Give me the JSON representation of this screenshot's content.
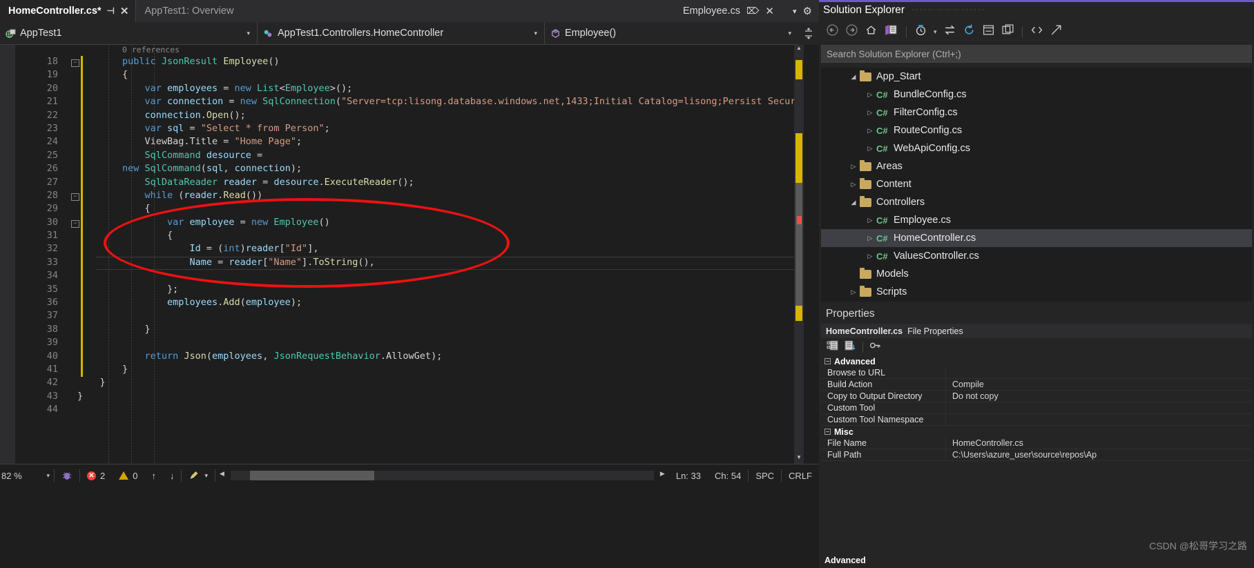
{
  "tabs": [
    {
      "label": "HomeController.cs*",
      "active": true,
      "pin": "⊣",
      "close": "✕"
    },
    {
      "label": "AppTest1: Overview",
      "active": false
    }
  ],
  "right_tab": {
    "label": "Employee.cs",
    "pin_icon": "pin-icon",
    "close": "✕",
    "dropdown": "▾",
    "gear": "⚙"
  },
  "navbar": {
    "project": "AppTest1",
    "class": "AppTest1.Controllers.HomeController",
    "member": "Employee()",
    "caret": "▾",
    "splitter_icon": "split-window-icon"
  },
  "editor": {
    "codelens": "0 references",
    "first_line": 18,
    "current_line": 33,
    "lines": [
      {
        "n": 18,
        "fold": "−",
        "change": true,
        "indent": 0,
        "tokens": [
          {
            "t": "public ",
            "c": "kw"
          },
          {
            "t": "JsonResult ",
            "c": "ty"
          },
          {
            "t": "Employee",
            "c": "me"
          },
          {
            "t": "()",
            "c": "pl"
          }
        ]
      },
      {
        "n": 19,
        "fold": "",
        "change": true,
        "indent": 0,
        "tokens": [
          {
            "t": "{",
            "c": "pl"
          }
        ]
      },
      {
        "n": 20,
        "fold": "",
        "change": true,
        "indent": 1,
        "tokens": [
          {
            "t": "var ",
            "c": "kw"
          },
          {
            "t": "employees",
            "c": "va"
          },
          {
            "t": " = ",
            "c": "pl"
          },
          {
            "t": "new ",
            "c": "kw"
          },
          {
            "t": "List",
            "c": "ty"
          },
          {
            "t": "<",
            "c": "pl"
          },
          {
            "t": "Employee",
            "c": "ty"
          },
          {
            "t": ">();",
            "c": "pl"
          }
        ]
      },
      {
        "n": 21,
        "fold": "",
        "change": true,
        "indent": 1,
        "tokens": [
          {
            "t": "var ",
            "c": "kw"
          },
          {
            "t": "connection",
            "c": "va"
          },
          {
            "t": " = ",
            "c": "pl"
          },
          {
            "t": "new ",
            "c": "kw"
          },
          {
            "t": "SqlConnection",
            "c": "ty"
          },
          {
            "t": "(",
            "c": "pl"
          },
          {
            "t": "\"Server=tcp:lisong.database.windows.net,1433;Initial Catalog=lisong;Persist Secur",
            "c": "st"
          }
        ]
      },
      {
        "n": 22,
        "fold": "",
        "change": true,
        "indent": 1,
        "tokens": [
          {
            "t": "connection",
            "c": "va"
          },
          {
            "t": ".",
            "c": "pl"
          },
          {
            "t": "Open",
            "c": "me"
          },
          {
            "t": "();",
            "c": "pl"
          }
        ]
      },
      {
        "n": 23,
        "fold": "",
        "change": true,
        "indent": 1,
        "tokens": [
          {
            "t": "var ",
            "c": "kw"
          },
          {
            "t": "sql",
            "c": "va"
          },
          {
            "t": " = ",
            "c": "pl"
          },
          {
            "t": "\"Select * from Person\"",
            "c": "st"
          },
          {
            "t": ";",
            "c": "pl"
          }
        ]
      },
      {
        "n": 24,
        "fold": "",
        "change": true,
        "indent": 1,
        "tokens": [
          {
            "t": "ViewBag",
            "c": "pl"
          },
          {
            "t": ".",
            "c": "pl"
          },
          {
            "t": "Title",
            "c": "pl"
          },
          {
            "t": " = ",
            "c": "pl"
          },
          {
            "t": "\"Home Page\"",
            "c": "st"
          },
          {
            "t": ";",
            "c": "pl"
          }
        ]
      },
      {
        "n": 25,
        "fold": "",
        "change": true,
        "indent": 1,
        "tokens": [
          {
            "t": "SqlCommand ",
            "c": "ty"
          },
          {
            "t": "desource",
            "c": "va"
          },
          {
            "t": " =",
            "c": "pl"
          }
        ]
      },
      {
        "n": 26,
        "fold": "",
        "change": true,
        "indent": -1,
        "tokens": [
          {
            "t": "new ",
            "c": "kw"
          },
          {
            "t": "SqlCommand",
            "c": "ty"
          },
          {
            "t": "(",
            "c": "pl"
          },
          {
            "t": "sql",
            "c": "va"
          },
          {
            "t": ", ",
            "c": "pl"
          },
          {
            "t": "connection",
            "c": "va"
          },
          {
            "t": ");",
            "c": "pl"
          }
        ]
      },
      {
        "n": 27,
        "fold": "",
        "change": true,
        "indent": 1,
        "tokens": [
          {
            "t": "SqlDataReader ",
            "c": "ty"
          },
          {
            "t": "reader",
            "c": "va"
          },
          {
            "t": " = ",
            "c": "pl"
          },
          {
            "t": "desource",
            "c": "va"
          },
          {
            "t": ".",
            "c": "pl"
          },
          {
            "t": "ExecuteReader",
            "c": "me"
          },
          {
            "t": "();",
            "c": "pl"
          }
        ]
      },
      {
        "n": 28,
        "fold": "−",
        "change": true,
        "indent": 1,
        "tokens": [
          {
            "t": "while ",
            "c": "kw"
          },
          {
            "t": "(",
            "c": "pl"
          },
          {
            "t": "reader",
            "c": "va"
          },
          {
            "t": ".",
            "c": "pl"
          },
          {
            "t": "Read",
            "c": "me"
          },
          {
            "t": "())",
            "c": "pl"
          }
        ]
      },
      {
        "n": 29,
        "fold": "",
        "change": true,
        "indent": 1,
        "tokens": [
          {
            "t": "{",
            "c": "pl"
          }
        ]
      },
      {
        "n": 30,
        "fold": "−",
        "change": true,
        "indent": 2,
        "tokens": [
          {
            "t": "var ",
            "c": "kw"
          },
          {
            "t": "employee",
            "c": "va"
          },
          {
            "t": " = ",
            "c": "pl"
          },
          {
            "t": "new ",
            "c": "kw"
          },
          {
            "t": "Employee",
            "c": "ty"
          },
          {
            "t": "()",
            "c": "pl"
          }
        ]
      },
      {
        "n": 31,
        "fold": "",
        "change": true,
        "indent": 2,
        "tokens": [
          {
            "t": "{",
            "c": "pl"
          }
        ]
      },
      {
        "n": 32,
        "fold": "",
        "change": true,
        "indent": 3,
        "tokens": [
          {
            "t": "Id",
            "c": "va"
          },
          {
            "t": " = (",
            "c": "pl"
          },
          {
            "t": "int",
            "c": "kw"
          },
          {
            "t": ")",
            "c": "pl"
          },
          {
            "t": "reader",
            "c": "va"
          },
          {
            "t": "[",
            "c": "pl"
          },
          {
            "t": "\"Id\"",
            "c": "st"
          },
          {
            "t": "],",
            "c": "pl"
          }
        ]
      },
      {
        "n": 33,
        "fold": "",
        "change": true,
        "indent": 3,
        "tokens": [
          {
            "t": "Name",
            "c": "va"
          },
          {
            "t": " = ",
            "c": "pl"
          },
          {
            "t": "reader",
            "c": "va"
          },
          {
            "t": "[",
            "c": "pl"
          },
          {
            "t": "\"Name\"",
            "c": "st"
          },
          {
            "t": "].",
            "c": "pl"
          },
          {
            "t": "ToString",
            "c": "me"
          },
          {
            "t": "(),",
            "c": "pl"
          }
        ]
      },
      {
        "n": 34,
        "fold": "",
        "change": true,
        "indent": 0,
        "tokens": []
      },
      {
        "n": 35,
        "fold": "",
        "change": true,
        "indent": 2,
        "tokens": [
          {
            "t": "};",
            "c": "pl"
          }
        ]
      },
      {
        "n": 36,
        "fold": "",
        "change": true,
        "indent": 2,
        "tokens": [
          {
            "t": "employees",
            "c": "va"
          },
          {
            "t": ".",
            "c": "pl"
          },
          {
            "t": "Add",
            "c": "me"
          },
          {
            "t": "(",
            "c": "pl"
          },
          {
            "t": "employee",
            "c": "va"
          },
          {
            "t": ");",
            "c": "pl"
          }
        ]
      },
      {
        "n": 37,
        "fold": "",
        "change": true,
        "indent": 0,
        "tokens": []
      },
      {
        "n": 38,
        "fold": "",
        "change": true,
        "indent": 1,
        "tokens": [
          {
            "t": "}",
            "c": "pl"
          }
        ]
      },
      {
        "n": 39,
        "fold": "",
        "change": true,
        "indent": 0,
        "tokens": []
      },
      {
        "n": 40,
        "fold": "",
        "change": true,
        "indent": 1,
        "tokens": [
          {
            "t": "return ",
            "c": "kw"
          },
          {
            "t": "Json",
            "c": "me"
          },
          {
            "t": "(",
            "c": "pl"
          },
          {
            "t": "employees",
            "c": "va"
          },
          {
            "t": ", ",
            "c": "pl"
          },
          {
            "t": "JsonRequestBehavior",
            "c": "ty"
          },
          {
            "t": ".",
            "c": "pl"
          },
          {
            "t": "AllowGet",
            "c": "pl"
          },
          {
            "t": ");",
            "c": "pl"
          }
        ]
      },
      {
        "n": 41,
        "fold": "",
        "change": true,
        "indent": 0,
        "tokens": [
          {
            "t": "}",
            "c": "pl"
          }
        ]
      },
      {
        "n": 42,
        "fold": "",
        "change": false,
        "indent": -2,
        "tokens": [
          {
            "t": "}",
            "c": "pl"
          }
        ]
      },
      {
        "n": 43,
        "fold": "",
        "change": false,
        "indent": -3,
        "tokens": [
          {
            "t": "}",
            "c": "pl"
          }
        ]
      },
      {
        "n": 44,
        "fold": "",
        "change": false,
        "indent": 0,
        "tokens": []
      }
    ]
  },
  "statusbar": {
    "zoom": "82 %",
    "zoom_caret": "▾",
    "bug_icon": "bug-icon",
    "error_count": "2",
    "warning_count": "0",
    "up_arrow": "↑",
    "down_arrow": "↓",
    "brush_icon": "broom-icon",
    "brush_caret": "▾",
    "left_arrow": "◀",
    "right_arrow": "▶",
    "line": "Ln: 33",
    "col": "Ch: 54",
    "spaces": "SPC",
    "eol": "CRLF"
  },
  "solution_explorer": {
    "title": "Solution Explorer",
    "toolbar_icons": [
      "back-arrow-icon",
      "forward-arrow-icon",
      "home-icon",
      "solution-view-icon",
      "pending-changes-icon",
      "sync-icon",
      "refresh-icon",
      "collapse-all-icon",
      "properties-window-icon",
      "show-all-files-icon",
      "preview-icon"
    ],
    "search_placeholder": "Search Solution Explorer (Ctrl+;)",
    "tree": [
      {
        "label": "App_Start",
        "type": "folder",
        "depth": 1,
        "state": "expanded",
        "selected": false
      },
      {
        "label": "BundleConfig.cs",
        "type": "cs",
        "depth": 2,
        "state": "collapsed",
        "selected": false
      },
      {
        "label": "FilterConfig.cs",
        "type": "cs",
        "depth": 2,
        "state": "collapsed",
        "selected": false
      },
      {
        "label": "RouteConfig.cs",
        "type": "cs",
        "depth": 2,
        "state": "collapsed",
        "selected": false
      },
      {
        "label": "WebApiConfig.cs",
        "type": "cs",
        "depth": 2,
        "state": "collapsed",
        "selected": false
      },
      {
        "label": "Areas",
        "type": "folder",
        "depth": 1,
        "state": "collapsed",
        "selected": false
      },
      {
        "label": "Content",
        "type": "folder",
        "depth": 1,
        "state": "collapsed",
        "selected": false
      },
      {
        "label": "Controllers",
        "type": "folder",
        "depth": 1,
        "state": "expanded",
        "selected": false
      },
      {
        "label": "Employee.cs",
        "type": "cs",
        "depth": 2,
        "state": "collapsed",
        "selected": false
      },
      {
        "label": "HomeController.cs",
        "type": "cs",
        "depth": 2,
        "state": "collapsed",
        "selected": true
      },
      {
        "label": "ValuesController.cs",
        "type": "cs",
        "depth": 2,
        "state": "collapsed",
        "selected": false
      },
      {
        "label": "Models",
        "type": "folder",
        "depth": 1,
        "state": "none",
        "selected": false
      },
      {
        "label": "Scripts",
        "type": "folder",
        "depth": 1,
        "state": "collapsed",
        "selected": false
      }
    ]
  },
  "properties": {
    "title": "Properties",
    "object_name": "HomeController.cs",
    "object_type": "File Properties",
    "toolbar_icons": [
      "categorized-icon",
      "alphabetical-icon",
      "property-pages-icon"
    ],
    "categories": [
      {
        "name": "Advanced",
        "expander": "⊟",
        "rows": [
          {
            "key": "Browse to URL",
            "value": ""
          },
          {
            "key": "Build Action",
            "value": "Compile"
          },
          {
            "key": "Copy to Output Directory",
            "value": "Do not copy"
          },
          {
            "key": "Custom Tool",
            "value": ""
          },
          {
            "key": "Custom Tool Namespace",
            "value": ""
          }
        ]
      },
      {
        "name": "Misc",
        "expander": "⊟",
        "rows": [
          {
            "key": "File Name",
            "value": "HomeController.cs"
          },
          {
            "key": "Full Path",
            "value": "C:\\Users\\azure_user\\source\\repos\\Ap"
          }
        ]
      }
    ],
    "footer": "Advanced"
  },
  "watermark": "CSDN @松哥学习之路",
  "colors": {
    "accent": "#6a5acd",
    "annotation": "#ee1111",
    "error": "#e8453c",
    "warning": "#d7a500",
    "change_bar": "#d7b600"
  }
}
